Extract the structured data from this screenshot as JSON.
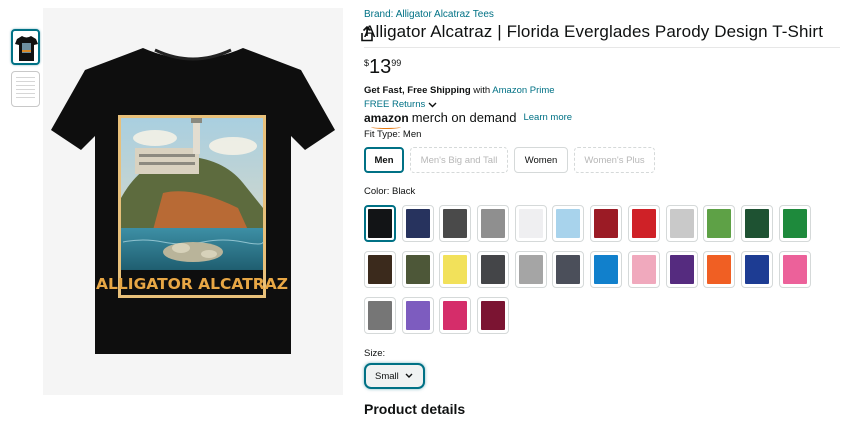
{
  "product": {
    "brand_link": "Brand: Alligator Alcatraz Tees",
    "title": "Alligator Alcatraz | Florida Everglades Parody Design T-Shirt",
    "image_text": "ALLIGATOR ALCATRAZ",
    "price": {
      "symbol": "$",
      "whole": "13",
      "fraction": "99"
    },
    "shipping": {
      "bold": "Get Fast, Free Shipping",
      "with": " with ",
      "prime_link": "Amazon Prime"
    },
    "returns_link": "FREE Returns",
    "merch": {
      "logo_amazon": "amazon",
      "logo_rest": "merch on demand",
      "learn_more": "Learn more"
    },
    "fit_type": {
      "label": "Fit Type: ",
      "selected": "Men",
      "options": [
        {
          "label": "Men",
          "state": "selected"
        },
        {
          "label": "Men's Big and Tall",
          "state": "unavailable"
        },
        {
          "label": "Women",
          "state": "available"
        },
        {
          "label": "Women's Plus",
          "state": "unavailable"
        }
      ]
    },
    "color": {
      "label": "Color: ",
      "selected": "Black",
      "swatches": [
        "#121416",
        "#27335e",
        "#4a4a4a",
        "#8f8f8f",
        "#efeff1",
        "#a8d3ec",
        "#9b1b25",
        "#cf2127",
        "#c9c9c9",
        "#5ea146",
        "#1e5232",
        "#1e8a3c",
        "#3b2a1c",
        "#4d5738",
        "#f2e15a",
        "#444548",
        "#a5a5a5",
        "#4b4f5a",
        "#1180cc",
        "#f0a9bd",
        "#552b7f",
        "#f05f23",
        "#1d3c93",
        "#ec619a",
        "#767676",
        "#7d5cbf",
        "#d52d6a",
        "#7b1432"
      ]
    },
    "size": {
      "label": "Size:",
      "selected": "Small"
    },
    "details_heading": "Product details"
  }
}
